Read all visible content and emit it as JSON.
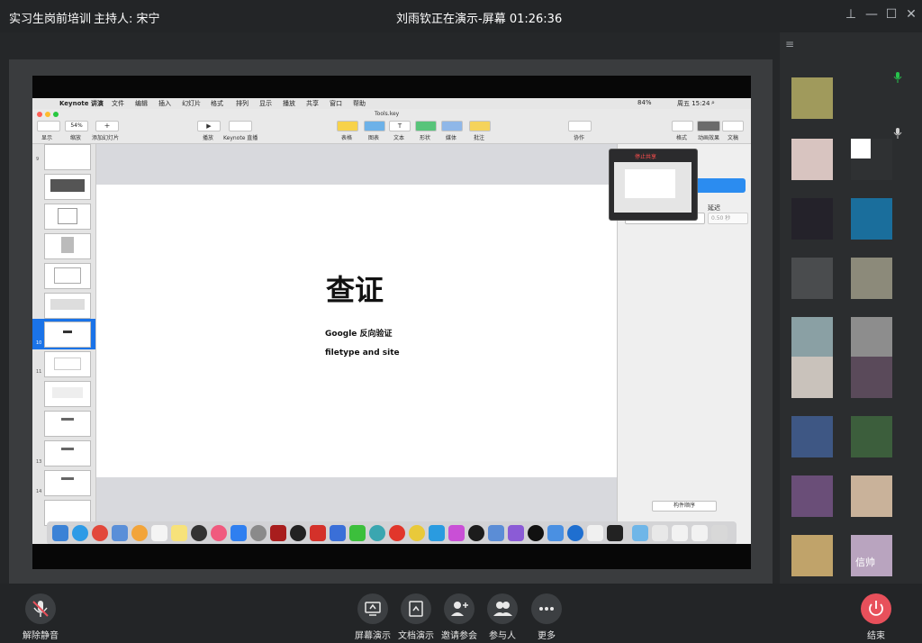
{
  "meeting": {
    "title": "实习生岗前培训",
    "host": "主持人: 宋宁",
    "presenter_status": "刘雨钦正在演示-屏幕 01:26:36"
  },
  "mac": {
    "menu": [
      "Keynote 讲演",
      "文件",
      "编辑",
      "插入",
      "幻灯片",
      "格式",
      "排列",
      "显示",
      "播放",
      "共享",
      "窗口",
      "帮助"
    ],
    "status_right": "周五 15:24",
    "battery": "84%",
    "doc_name": "Tools.key",
    "zoom": "54%",
    "toolbar_labels": {
      "view": "显示",
      "zoom": "缩放",
      "add_slide": "添加幻灯片",
      "play": "播放",
      "live": "Keynote 直播",
      "table": "表格",
      "chart": "图表",
      "text": "文本",
      "shape": "形状",
      "media": "媒体",
      "comment": "批注",
      "collab": "协作",
      "format": "格式",
      "animate": "动画效果",
      "document": "文稿"
    },
    "thumbs": [
      "9",
      "",
      "",
      "",
      "",
      "",
      "",
      "10",
      "11",
      "",
      "",
      "",
      "13",
      "14"
    ],
    "slide": {
      "title": "查证",
      "line1": "Google 反向验证",
      "line2": "filetype and site"
    },
    "inspector": {
      "delay_label": "延迟",
      "trigger": "在点按时",
      "delay_value": "0.50 秒",
      "build_order": "构件顺序"
    },
    "pip_label": "停止共享"
  },
  "participants": {
    "tile_name": "信帅"
  },
  "controls": {
    "unmute": "解除静音",
    "screen_share": "屏幕演示",
    "doc_share": "文档演示",
    "invite": "邀请参会",
    "participants": "参与人",
    "more": "更多",
    "end": "结束"
  },
  "colors": {
    "end_button": "#e8505b",
    "mic_green": "#27c24c",
    "selected_thumb": "#1a73e8"
  }
}
